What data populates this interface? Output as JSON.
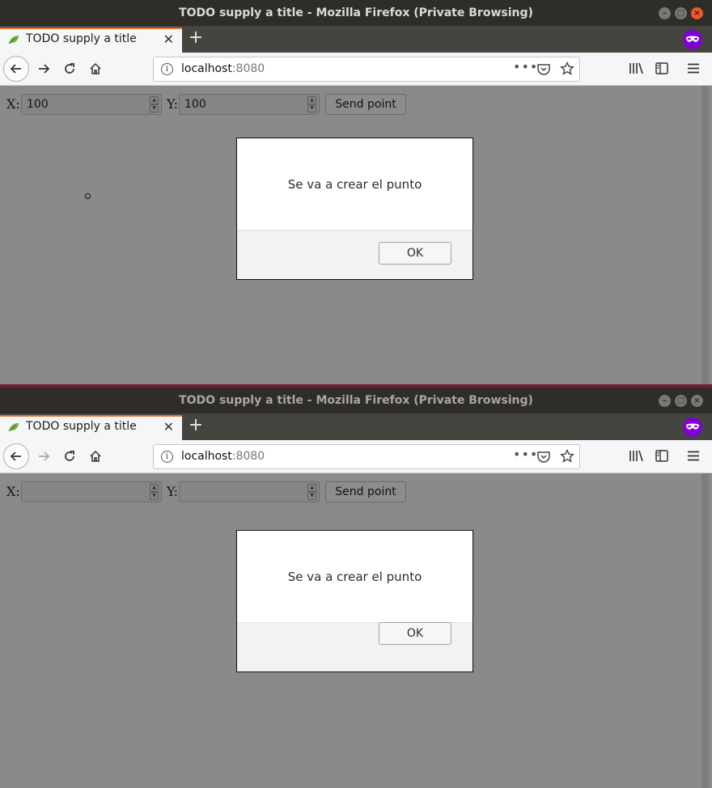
{
  "windows": [
    {
      "title": "TODO supply a title - Mozilla Firefox (Private Browsing)",
      "tab_title": "TODO supply a title",
      "url_host": "localhost",
      "url_port": ":8080",
      "form": {
        "x_label": "X:",
        "x_value": "100",
        "y_label": "Y:",
        "y_value": "100",
        "send_label": "Send point"
      },
      "dialog": {
        "message": "Se va a crear el punto",
        "ok_label": "OK"
      }
    },
    {
      "title": "TODO supply a title - Mozilla Firefox (Private Browsing)",
      "tab_title": "TODO supply a title",
      "url_host": "localhost",
      "url_port": ":8080",
      "form": {
        "x_label": "X:",
        "x_value": "",
        "y_label": "Y:",
        "y_value": "",
        "send_label": "Send point"
      },
      "dialog": {
        "message": "Se va a crear el punto",
        "ok_label": "OK"
      }
    }
  ],
  "colors": {
    "private_browsing": "#8000d7",
    "tab_accent": "#e66f2c",
    "close_button": "#e9592a"
  },
  "icons": [
    "close-icon",
    "maximize-icon",
    "minimize-icon",
    "leaf-favicon-icon",
    "tab-close-icon",
    "new-tab-icon",
    "private-browsing-icon",
    "back-icon",
    "forward-icon",
    "reload-icon",
    "home-icon",
    "info-icon",
    "page-actions-icon",
    "pocket-icon",
    "bookmark-star-icon",
    "library-icon",
    "sidebar-icon",
    "hamburger-menu-icon"
  ]
}
